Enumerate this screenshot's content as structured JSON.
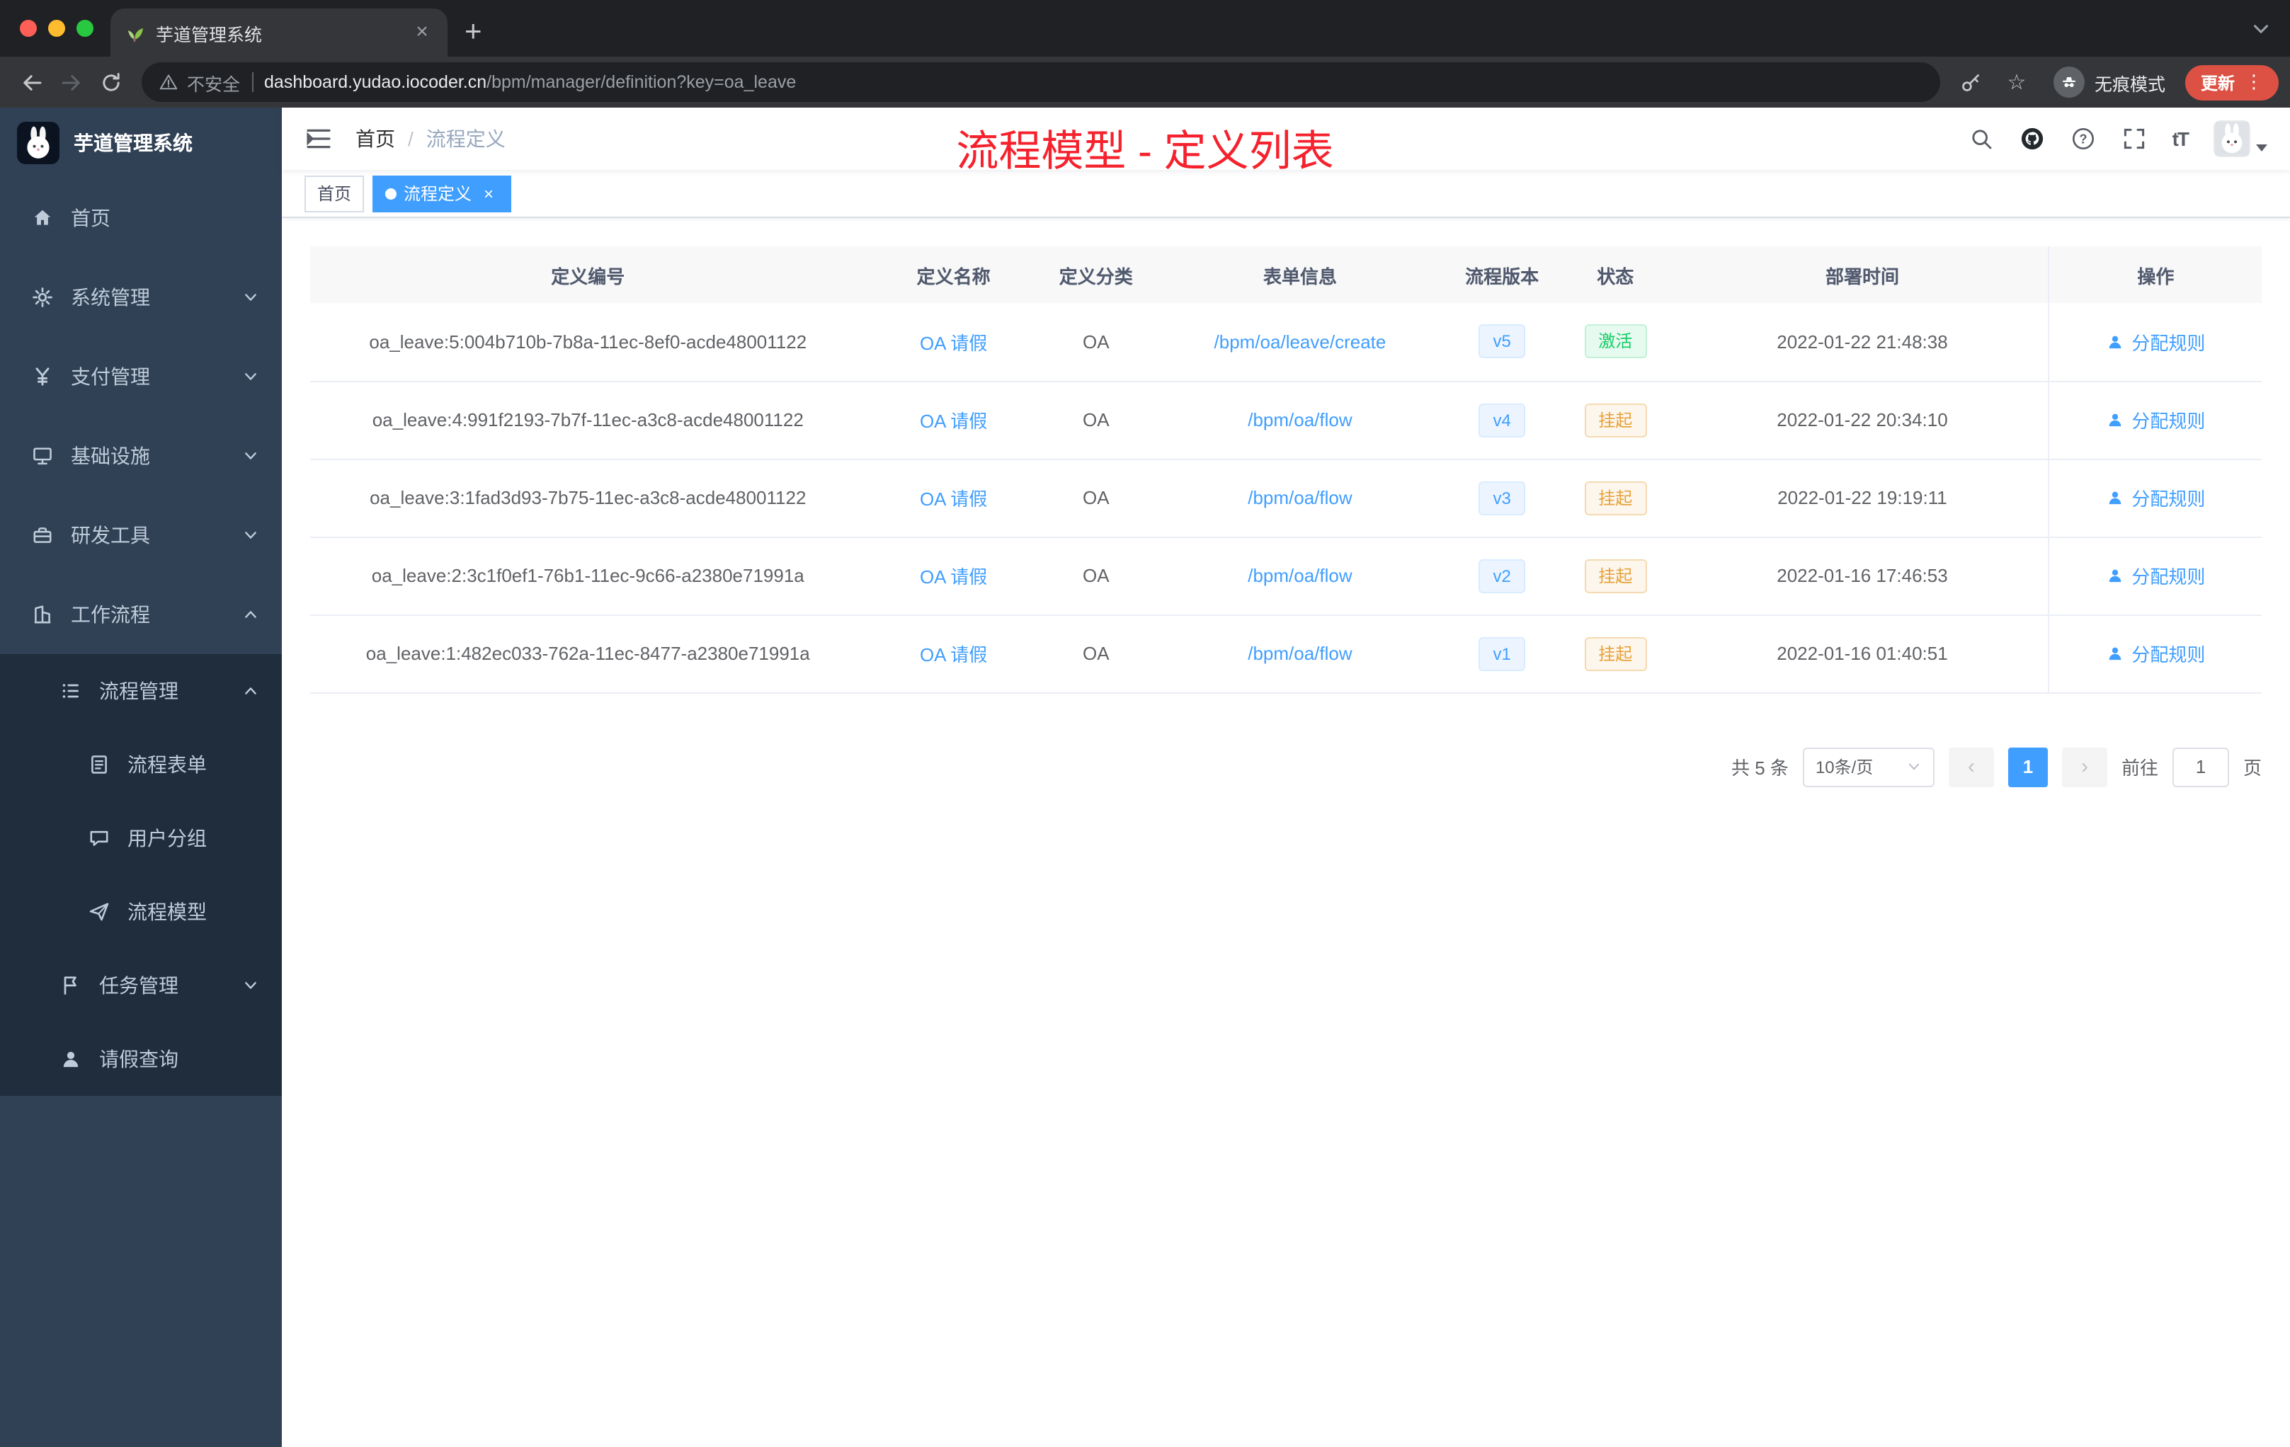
{
  "colors": {
    "accent": "#409eff",
    "annotation_red": "#f5222d",
    "success_green": "#13ce66",
    "warning_orange": "#e6a23c",
    "sidebar_bg": "#304156",
    "submenu_bg": "#1f2d3d"
  },
  "browser": {
    "tab_title": "芋道管理系统",
    "security_label": "不安全",
    "url_host": "dashboard.yudao.iocoder.cn",
    "url_path": "/bpm/manager/definition?key=oa_leave",
    "incognito_label": "无痕模式",
    "update_label": "更新"
  },
  "sidebar": {
    "logo_title": "芋道管理系统",
    "menu": [
      {
        "label": "首页",
        "icon": "home-icon",
        "level": 1,
        "expandable": false,
        "expanded": false,
        "sub": false
      },
      {
        "label": "系统管理",
        "icon": "gear-icon",
        "level": 1,
        "expandable": true,
        "expanded": false,
        "sub": false
      },
      {
        "label": "支付管理",
        "icon": "yen-icon",
        "level": 1,
        "expandable": true,
        "expanded": false,
        "sub": false
      },
      {
        "label": "基础设施",
        "icon": "monitor-icon",
        "level": 1,
        "expandable": true,
        "expanded": false,
        "sub": false
      },
      {
        "label": "研发工具",
        "icon": "toolbox-icon",
        "level": 1,
        "expandable": true,
        "expanded": false,
        "sub": false
      },
      {
        "label": "工作流程",
        "icon": "workflow-icon",
        "level": 1,
        "expandable": true,
        "expanded": true,
        "sub": false
      },
      {
        "label": "流程管理",
        "icon": "list-icon",
        "level": 2,
        "expandable": true,
        "expanded": true,
        "sub": true
      },
      {
        "label": "流程表单",
        "icon": "form-icon",
        "level": 3,
        "expandable": false,
        "expanded": false,
        "sub": true
      },
      {
        "label": "用户分组",
        "icon": "group-icon",
        "level": 3,
        "expandable": false,
        "expanded": false,
        "sub": true
      },
      {
        "label": "流程模型",
        "icon": "send-icon",
        "level": 3,
        "expandable": false,
        "expanded": false,
        "sub": true
      },
      {
        "label": "任务管理",
        "icon": "task-icon",
        "level": 2,
        "expandable": true,
        "expanded": false,
        "sub": true
      },
      {
        "label": "请假查询",
        "icon": "user-icon",
        "level": 2,
        "expandable": false,
        "expanded": false,
        "sub": true
      }
    ]
  },
  "header": {
    "breadcrumb": [
      "首页",
      "流程定义"
    ],
    "annotation": "流程模型 - 定义列表"
  },
  "tags": [
    {
      "label": "首页",
      "active": false,
      "closable": false
    },
    {
      "label": "流程定义",
      "active": true,
      "closable": true
    }
  ],
  "table": {
    "columns": [
      {
        "key": "id",
        "label": "定义编号"
      },
      {
        "key": "name",
        "label": "定义名称"
      },
      {
        "key": "category",
        "label": "定义分类"
      },
      {
        "key": "form",
        "label": "表单信息"
      },
      {
        "key": "version",
        "label": "流程版本"
      },
      {
        "key": "status",
        "label": "状态"
      },
      {
        "key": "time",
        "label": "部署时间"
      },
      {
        "key": "action",
        "label": "操作"
      }
    ],
    "rows": [
      {
        "id": "oa_leave:5:004b710b-7b8a-11ec-8ef0-acde48001122",
        "name": "OA 请假",
        "category": "OA",
        "form": "/bpm/oa/leave/create",
        "version": "v5",
        "status": "激活",
        "status_type": "success",
        "time": "2022-01-22 21:48:38",
        "action": "分配规则"
      },
      {
        "id": "oa_leave:4:991f2193-7b7f-11ec-a3c8-acde48001122",
        "name": "OA 请假",
        "category": "OA",
        "form": "/bpm/oa/flow",
        "version": "v4",
        "status": "挂起",
        "status_type": "warning",
        "time": "2022-01-22 20:34:10",
        "action": "分配规则"
      },
      {
        "id": "oa_leave:3:1fad3d93-7b75-11ec-a3c8-acde48001122",
        "name": "OA 请假",
        "category": "OA",
        "form": "/bpm/oa/flow",
        "version": "v3",
        "status": "挂起",
        "status_type": "warning",
        "time": "2022-01-22 19:19:11",
        "action": "分配规则"
      },
      {
        "id": "oa_leave:2:3c1f0ef1-76b1-11ec-9c66-a2380e71991a",
        "name": "OA 请假",
        "category": "OA",
        "form": "/bpm/oa/flow",
        "version": "v2",
        "status": "挂起",
        "status_type": "warning",
        "time": "2022-01-16 17:46:53",
        "action": "分配规则"
      },
      {
        "id": "oa_leave:1:482ec033-762a-11ec-8477-a2380e71991a",
        "name": "OA 请假",
        "category": "OA",
        "form": "/bpm/oa/flow",
        "version": "v1",
        "status": "挂起",
        "status_type": "warning",
        "time": "2022-01-16 01:40:51",
        "action": "分配规则"
      }
    ]
  },
  "pagination": {
    "total_label": "共 5 条",
    "page_size_label": "10条/页",
    "pages": [
      "1"
    ],
    "current": "1",
    "goto_label": "前往",
    "goto_value": "1",
    "goto_unit": "页"
  }
}
